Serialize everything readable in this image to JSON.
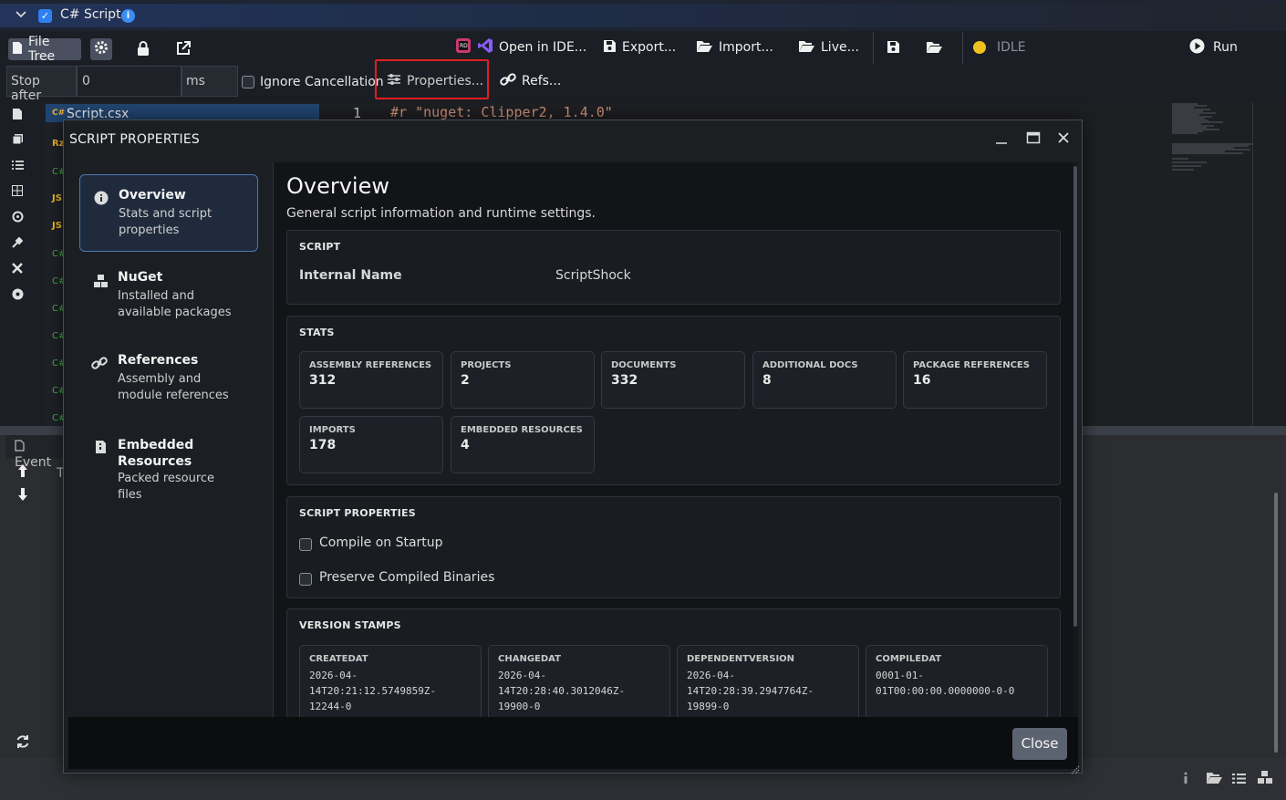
{
  "window": {
    "title": "C# Script",
    "info_icon": "i"
  },
  "toolbar": {
    "file_tree_label": "File Tree",
    "open_in_ide_label": "Open in IDE...",
    "export_label": "Export...",
    "import_label": "Import...",
    "live_label": "Live...",
    "status_label": "IDLE",
    "run_label": "Run",
    "stop_after_label": "Stop after",
    "stop_after_value": "0",
    "ms_label": "ms",
    "ignore_cancellation_label": "Ignore Cancellation",
    "properties_label": "Properties...",
    "refs_label": "Refs..."
  },
  "files": {
    "selected_name": "Script.csx",
    "tags": [
      "Rz",
      "C#",
      "JS",
      "JS",
      "C#",
      "C#",
      "C#",
      "C#",
      "C#",
      "C#",
      "C#"
    ]
  },
  "editor": {
    "line_number": "1",
    "code": "#r \"nuget: Clipper2, 1.4.0\""
  },
  "lower_panel": {
    "events_tab": "Event",
    "partial_text": "T"
  },
  "dialog": {
    "title": "SCRIPT PROPERTIES",
    "close_label": "Close",
    "nav": [
      {
        "title": "Overview",
        "subtitle": "Stats and script properties"
      },
      {
        "title": "NuGet",
        "subtitle": "Installed and available packages"
      },
      {
        "title": "References",
        "subtitle": "Assembly and module references"
      },
      {
        "title": "Embedded Resources",
        "subtitle": "Packed resource files"
      }
    ],
    "overview": {
      "heading": "Overview",
      "description": "General script information and runtime settings.",
      "script_section": "SCRIPT",
      "internal_name_label": "Internal Name",
      "internal_name_value": "ScriptShock",
      "stats_section": "STATS",
      "stats": [
        {
          "label": "ASSEMBLY REFERENCES",
          "value": "312"
        },
        {
          "label": "PROJECTS",
          "value": "2"
        },
        {
          "label": "DOCUMENTS",
          "value": "332"
        },
        {
          "label": "ADDITIONAL DOCS",
          "value": "8"
        },
        {
          "label": "PACKAGE REFERENCES",
          "value": "16"
        },
        {
          "label": "IMPORTS",
          "value": "178"
        },
        {
          "label": "EMBEDDED RESOURCES",
          "value": "4"
        }
      ],
      "script_props_section": "SCRIPT PROPERTIES",
      "compile_on_startup_label": "Compile on Startup",
      "preserve_binaries_label": "Preserve Compiled Binaries",
      "version_section": "VERSION STAMPS",
      "versions": [
        {
          "label": "CREATEDAT",
          "lines": [
            "2026-04-",
            "14T20:21:12.5749859Z-",
            "12244-0"
          ]
        },
        {
          "label": "CHANGEDAT",
          "lines": [
            "2026-04-",
            "14T20:28:40.3012046Z-",
            "19900-0"
          ]
        },
        {
          "label": "DEPENDENTVERSION",
          "lines": [
            "2026-04-",
            "14T20:28:39.2947764Z-",
            "19899-0"
          ]
        },
        {
          "label": "COMPILEDAT",
          "lines": [
            "0001-01-",
            "01T00:00:00.0000000-0-0"
          ]
        }
      ]
    }
  },
  "colors": {
    "accent": "#2f7ff0",
    "highlight_border": "#e02020",
    "status_dot": "#f0c020",
    "code_string": "#ce9178"
  },
  "icons": {
    "collapse": "chevron-down-icon",
    "lock": "lock-icon",
    "popout": "external-link-icon",
    "save": "save-icon",
    "folder": "folder-icon",
    "run": "play-icon",
    "refresh": "refresh-icon"
  }
}
